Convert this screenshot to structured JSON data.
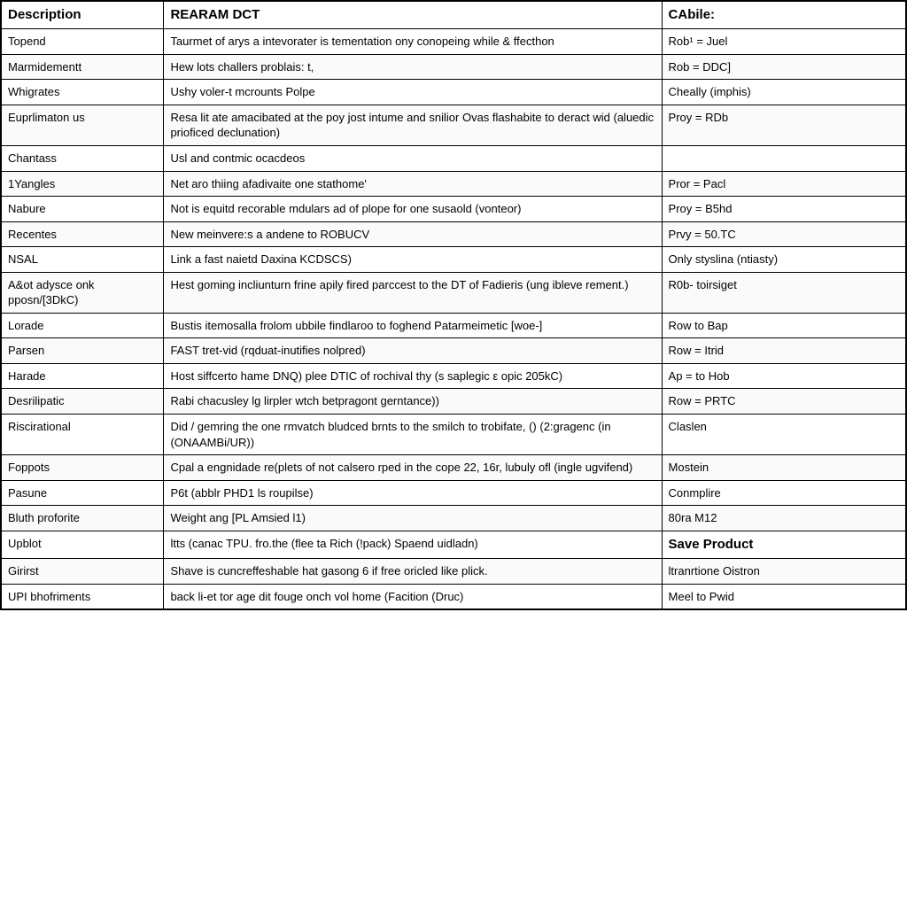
{
  "table": {
    "headers": {
      "description": "Description",
      "param": "REARAM DCT",
      "cable": "CAbile:"
    },
    "rows": [
      {
        "description": "Topend",
        "param": "Taurmet of arys a intevorater is tementation ony conopeing while & ffecthon",
        "cable": "Rob¹ = Juel"
      },
      {
        "description": "Marmidementt",
        "param": "Hew lots challers problais: t,",
        "cable": "Rob = DDC]"
      },
      {
        "description": "Whigrates",
        "param": "Ushy voler-t mcrounts Polpe",
        "cable": "Cheally (imphis)"
      },
      {
        "description": "Euprlimaton us",
        "param": "Resa lit ate amacibated at the poy jost intume and snilior Ovas flashabite to deract wid (aluedic prioficed declunation)",
        "cable": "Proy = RDb"
      },
      {
        "description": "Chantass",
        "param": "Usl and contmic ocacdeos",
        "cable": ""
      },
      {
        "description": "1Yangles",
        "param": "Net aro thiing afadivaite one stathome'",
        "cable": "Pror = Pacl"
      },
      {
        "description": "Nabure",
        "param": "Not is equitd recorable mdulars ad of plope for one susaold (vonteor)",
        "cable": "Proy = B5hd"
      },
      {
        "description": "Recentes",
        "param": "New meinvere:s a andene to ROBUCV",
        "cable": "Prvy = 50.TC"
      },
      {
        "description": "NSAL",
        "param": "Link a fast naietd Daxina KCDSCS)",
        "cable": "Only styslina (ntiasty)"
      },
      {
        "description": "A&ot adysce onk pposn/[3DkC)",
        "param": "Hest goming incliunturn frine apily fired parccest to the DT of Fadieris (ung ibleve rement.)",
        "cable": "R0b- toirsiget"
      },
      {
        "description": "Lorade",
        "param": "Bustis itemosalla frolom ubbile findlaroo to foghend Patarmeimetic [woe-]",
        "cable": "Row to Bap"
      },
      {
        "description": "Parsen",
        "param": "FAST tret-vid (rqduat-inutifies nolpred)",
        "cable": "Row = Itrid"
      },
      {
        "description": "Harade",
        "param": "Host siffcerto hame DNQ) plee DTIC of rochival thy (s saplegic ε opic 205kC)",
        "cable": "Ap = to Hob"
      },
      {
        "description": "Desrilipatic",
        "param": "Rabi chacusley lg lirpler wtch betpragont gerntance))",
        "cable": "Row = PRTC"
      },
      {
        "description": "Riscirational",
        "param": "Did / gemring the one rmvatch bludced brnts to the smilch to trobifate, () (2:gragenc (in (ONAAMBi/UR))",
        "cable": "Claslen"
      },
      {
        "description": "Foppots",
        "param": "Cpal a engnidade re(plets of not calsero rped in the cope 22, 16r, lubuly ofl (ingle ugvifend)",
        "cable": "Mostein"
      },
      {
        "description": "Pasune",
        "param": "P6t (abblr PHD1 ls roupilse)",
        "cable": "Conmplire"
      },
      {
        "description": "Bluth proforite",
        "param": "Weight ang [PL Amsied l1)",
        "cable": "80ra M12"
      },
      {
        "description": "Upblot",
        "param": "ltts (canac TPU. fro.the (flee ta Rich (!pack) Spaend uidladn)",
        "cable": "Save Product"
      },
      {
        "description": "Girirst",
        "param": "Shave is cuncreffeshable hat gasong 6 if free oricled like plick.",
        "cable": "ltranrtione Oistron"
      },
      {
        "description": "UPI bhofriments",
        "param": "back li-et tor age dit fouge onch vol home (Facition (Druc)",
        "cable": "Meel to Pwid"
      }
    ]
  }
}
